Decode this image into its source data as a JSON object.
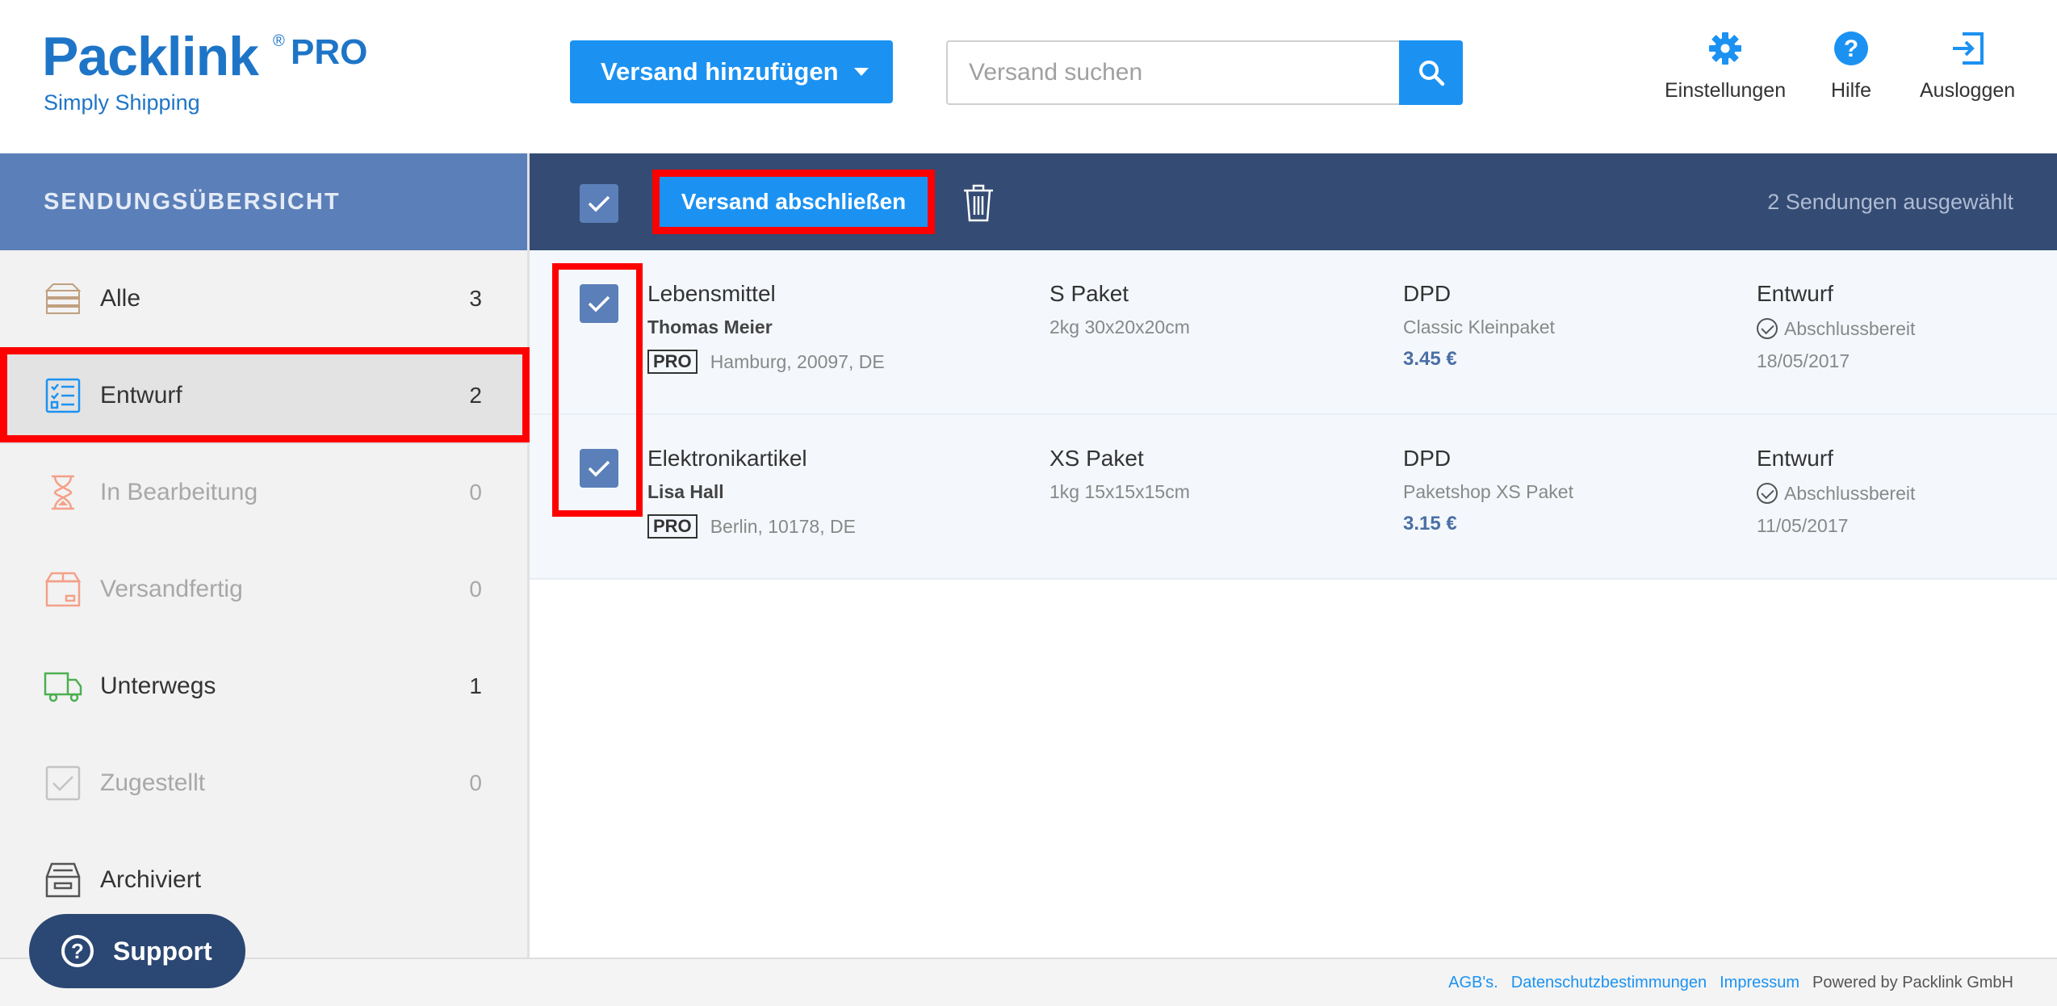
{
  "logo": {
    "name": "Packlink",
    "reg": "®",
    "pro": "PRO",
    "tagline": "Simply Shipping"
  },
  "header": {
    "add_button": "Versand hinzufügen",
    "search_placeholder": "Versand suchen",
    "actions": [
      {
        "label": "Einstellungen",
        "icon": "gear-icon"
      },
      {
        "label": "Hilfe",
        "icon": "help-icon"
      },
      {
        "label": "Ausloggen",
        "icon": "logout-icon"
      }
    ]
  },
  "sidebar": {
    "title": "SENDUNGSÜBERSICHT",
    "items": [
      {
        "label": "Alle",
        "count": "3",
        "icon": "stack-icon"
      },
      {
        "label": "Entwurf",
        "count": "2",
        "icon": "checklist-icon"
      },
      {
        "label": "In Bearbeitung",
        "count": "0",
        "icon": "hourglass-icon"
      },
      {
        "label": "Versandfertig",
        "count": "0",
        "icon": "box-icon"
      },
      {
        "label": "Unterwegs",
        "count": "1",
        "icon": "truck-icon"
      },
      {
        "label": "Zugestellt",
        "count": "0",
        "icon": "delivered-icon"
      },
      {
        "label": "Archiviert",
        "count": "",
        "icon": "archive-icon"
      }
    ],
    "active_item": "Entwurf"
  },
  "support": {
    "label": "Support"
  },
  "toolbar": {
    "close_button": "Versand abschließen",
    "selected_text": "2 Sendungen ausgewählt"
  },
  "shipments": [
    {
      "content": "Lebensmittel",
      "recipient": "Thomas Meier",
      "tag": "PRO",
      "address": "Hamburg, 20097, DE",
      "package": "S Paket",
      "package_details": "2kg 30x20x20cm",
      "carrier": "DPD",
      "service": "Classic Kleinpaket",
      "price": "3.45 €",
      "status": "Entwurf",
      "substatus": "Abschlussbereit",
      "date": "18/05/2017"
    },
    {
      "content": "Elektronikartikel",
      "recipient": "Lisa Hall",
      "tag": "PRO",
      "address": "Berlin, 10178, DE",
      "package": "XS Paket",
      "package_details": "1kg 15x15x15cm",
      "carrier": "DPD",
      "service": "Paketshop XS Paket",
      "price": "3.15 €",
      "status": "Entwurf",
      "substatus": "Abschlussbereit",
      "date": "11/05/2017"
    }
  ],
  "footer": {
    "links": [
      "AGB's.",
      "Datenschutzbestimmungen",
      "Impressum"
    ],
    "powered": "Powered by Packlink GmbH"
  },
  "colors": {
    "primary": "#1b92f2",
    "brand": "#1e75c7",
    "toolbar": "#344b73",
    "sidebar_header": "#5b7fb8",
    "highlight": "#ff0000"
  }
}
